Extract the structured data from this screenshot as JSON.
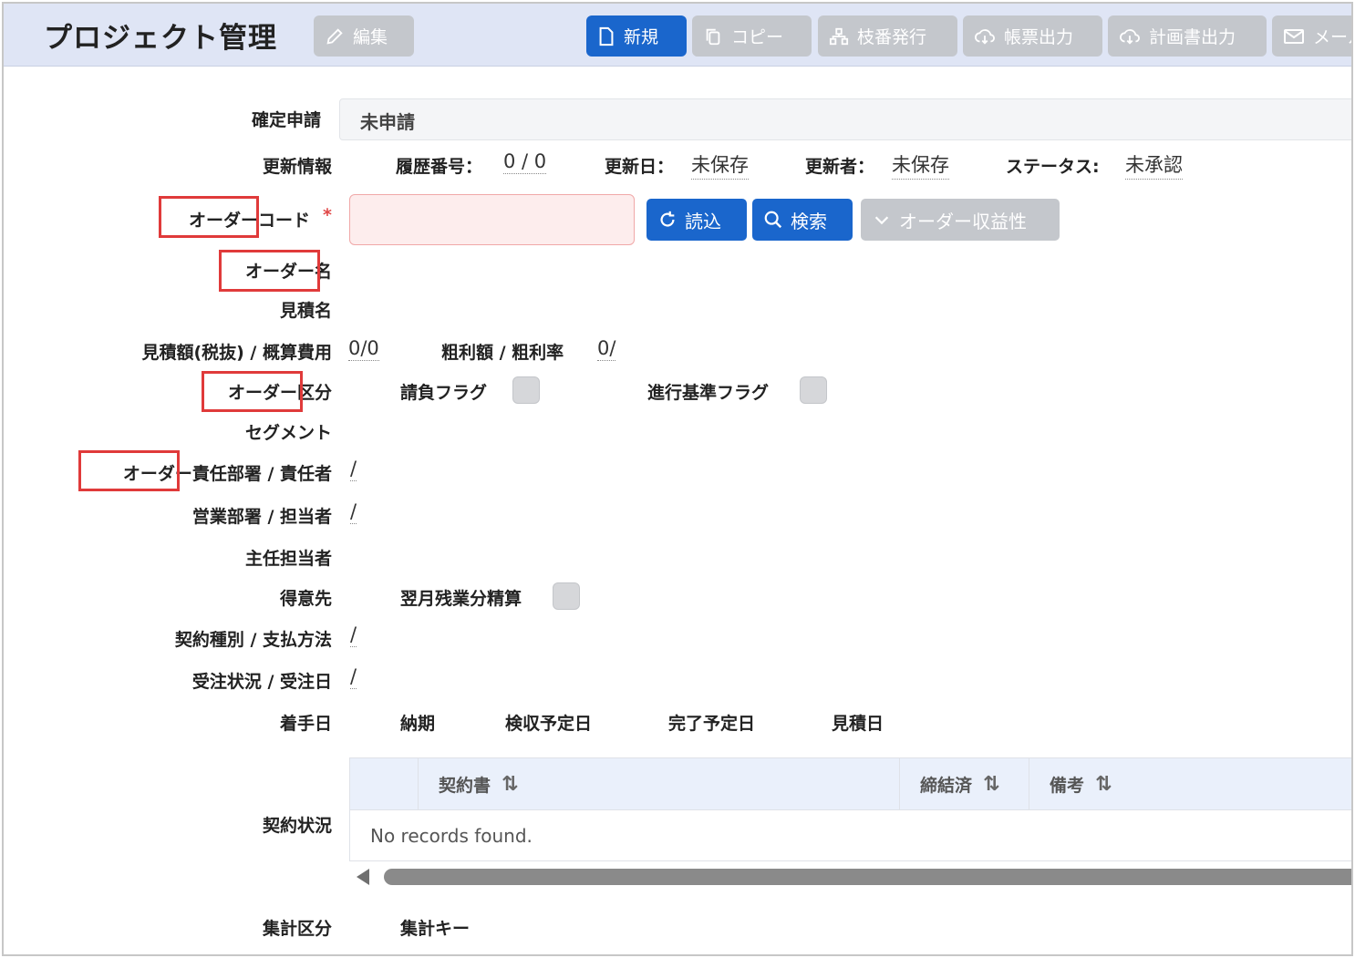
{
  "header": {
    "title": "プロジェクト管理",
    "buttons": {
      "edit": "編集",
      "new": "新規",
      "copy": "コピー",
      "branch": "枝番発行",
      "report": "帳票出力",
      "plan": "計画書出力",
      "mail": "メール"
    }
  },
  "form": {
    "confirm_apply": {
      "label": "確定申請",
      "value": "未申請"
    },
    "update_info": {
      "label": "更新情報",
      "history_label": "履歴番号：",
      "history_value": "0 / 0",
      "date_label": "更新日：",
      "date_value": "未保存",
      "user_label": "更新者：",
      "user_value": "未保存",
      "status_label": "ステータス:",
      "status_value": "未承認"
    },
    "order_code": {
      "label": "オーダーコード",
      "required_mark": "*",
      "value": "",
      "placeholder": ""
    },
    "actions": {
      "load": "読込",
      "search": "検索",
      "profit": "オーダー収益性"
    },
    "order_name": {
      "label": "オーダー名"
    },
    "estimate_name": {
      "label": "見積名"
    },
    "amounts": {
      "label": "見積額(税抜) / 概算費用",
      "value": "0/0",
      "gross_label": "粗利額 / 粗利率",
      "gross_value": "0/"
    },
    "order_type": {
      "label": "オーダー区分",
      "contract_flag": "請負フラグ",
      "progress_flag": "進行基準フラグ"
    },
    "segment": {
      "label": "セグメント"
    },
    "order_dept": {
      "label": "オーダー責任部署 / 責任者",
      "value": "/"
    },
    "sales_dept": {
      "label": "営業部署 / 担当者",
      "value": "/"
    },
    "chief": {
      "label": "主任担当者"
    },
    "customer": {
      "label": "得意先",
      "overtime_label": "翌月残業分精算"
    },
    "contract_type": {
      "label": "契約種別 / 支払方法",
      "value": "/"
    },
    "order_status": {
      "label": "受注状況 / 受注日",
      "value": "/"
    },
    "dates": {
      "start": "着手日",
      "delivery": "納期",
      "inspection": "検収予定日",
      "completion": "完了予定日",
      "estimate": "見積日"
    },
    "contract_status": {
      "label": "契約状況",
      "columns": [
        "契約書",
        "締結済",
        "備考"
      ],
      "sort_glyph": "⇅",
      "empty": "No records found."
    },
    "aggregation": {
      "label": "集計区分",
      "key_label": "集計キー"
    }
  },
  "colors": {
    "primary": "#1a66cc",
    "disabled": "#c4c7cc",
    "header_bg": "#dfe5f5",
    "highlight": "#e03a3a"
  }
}
